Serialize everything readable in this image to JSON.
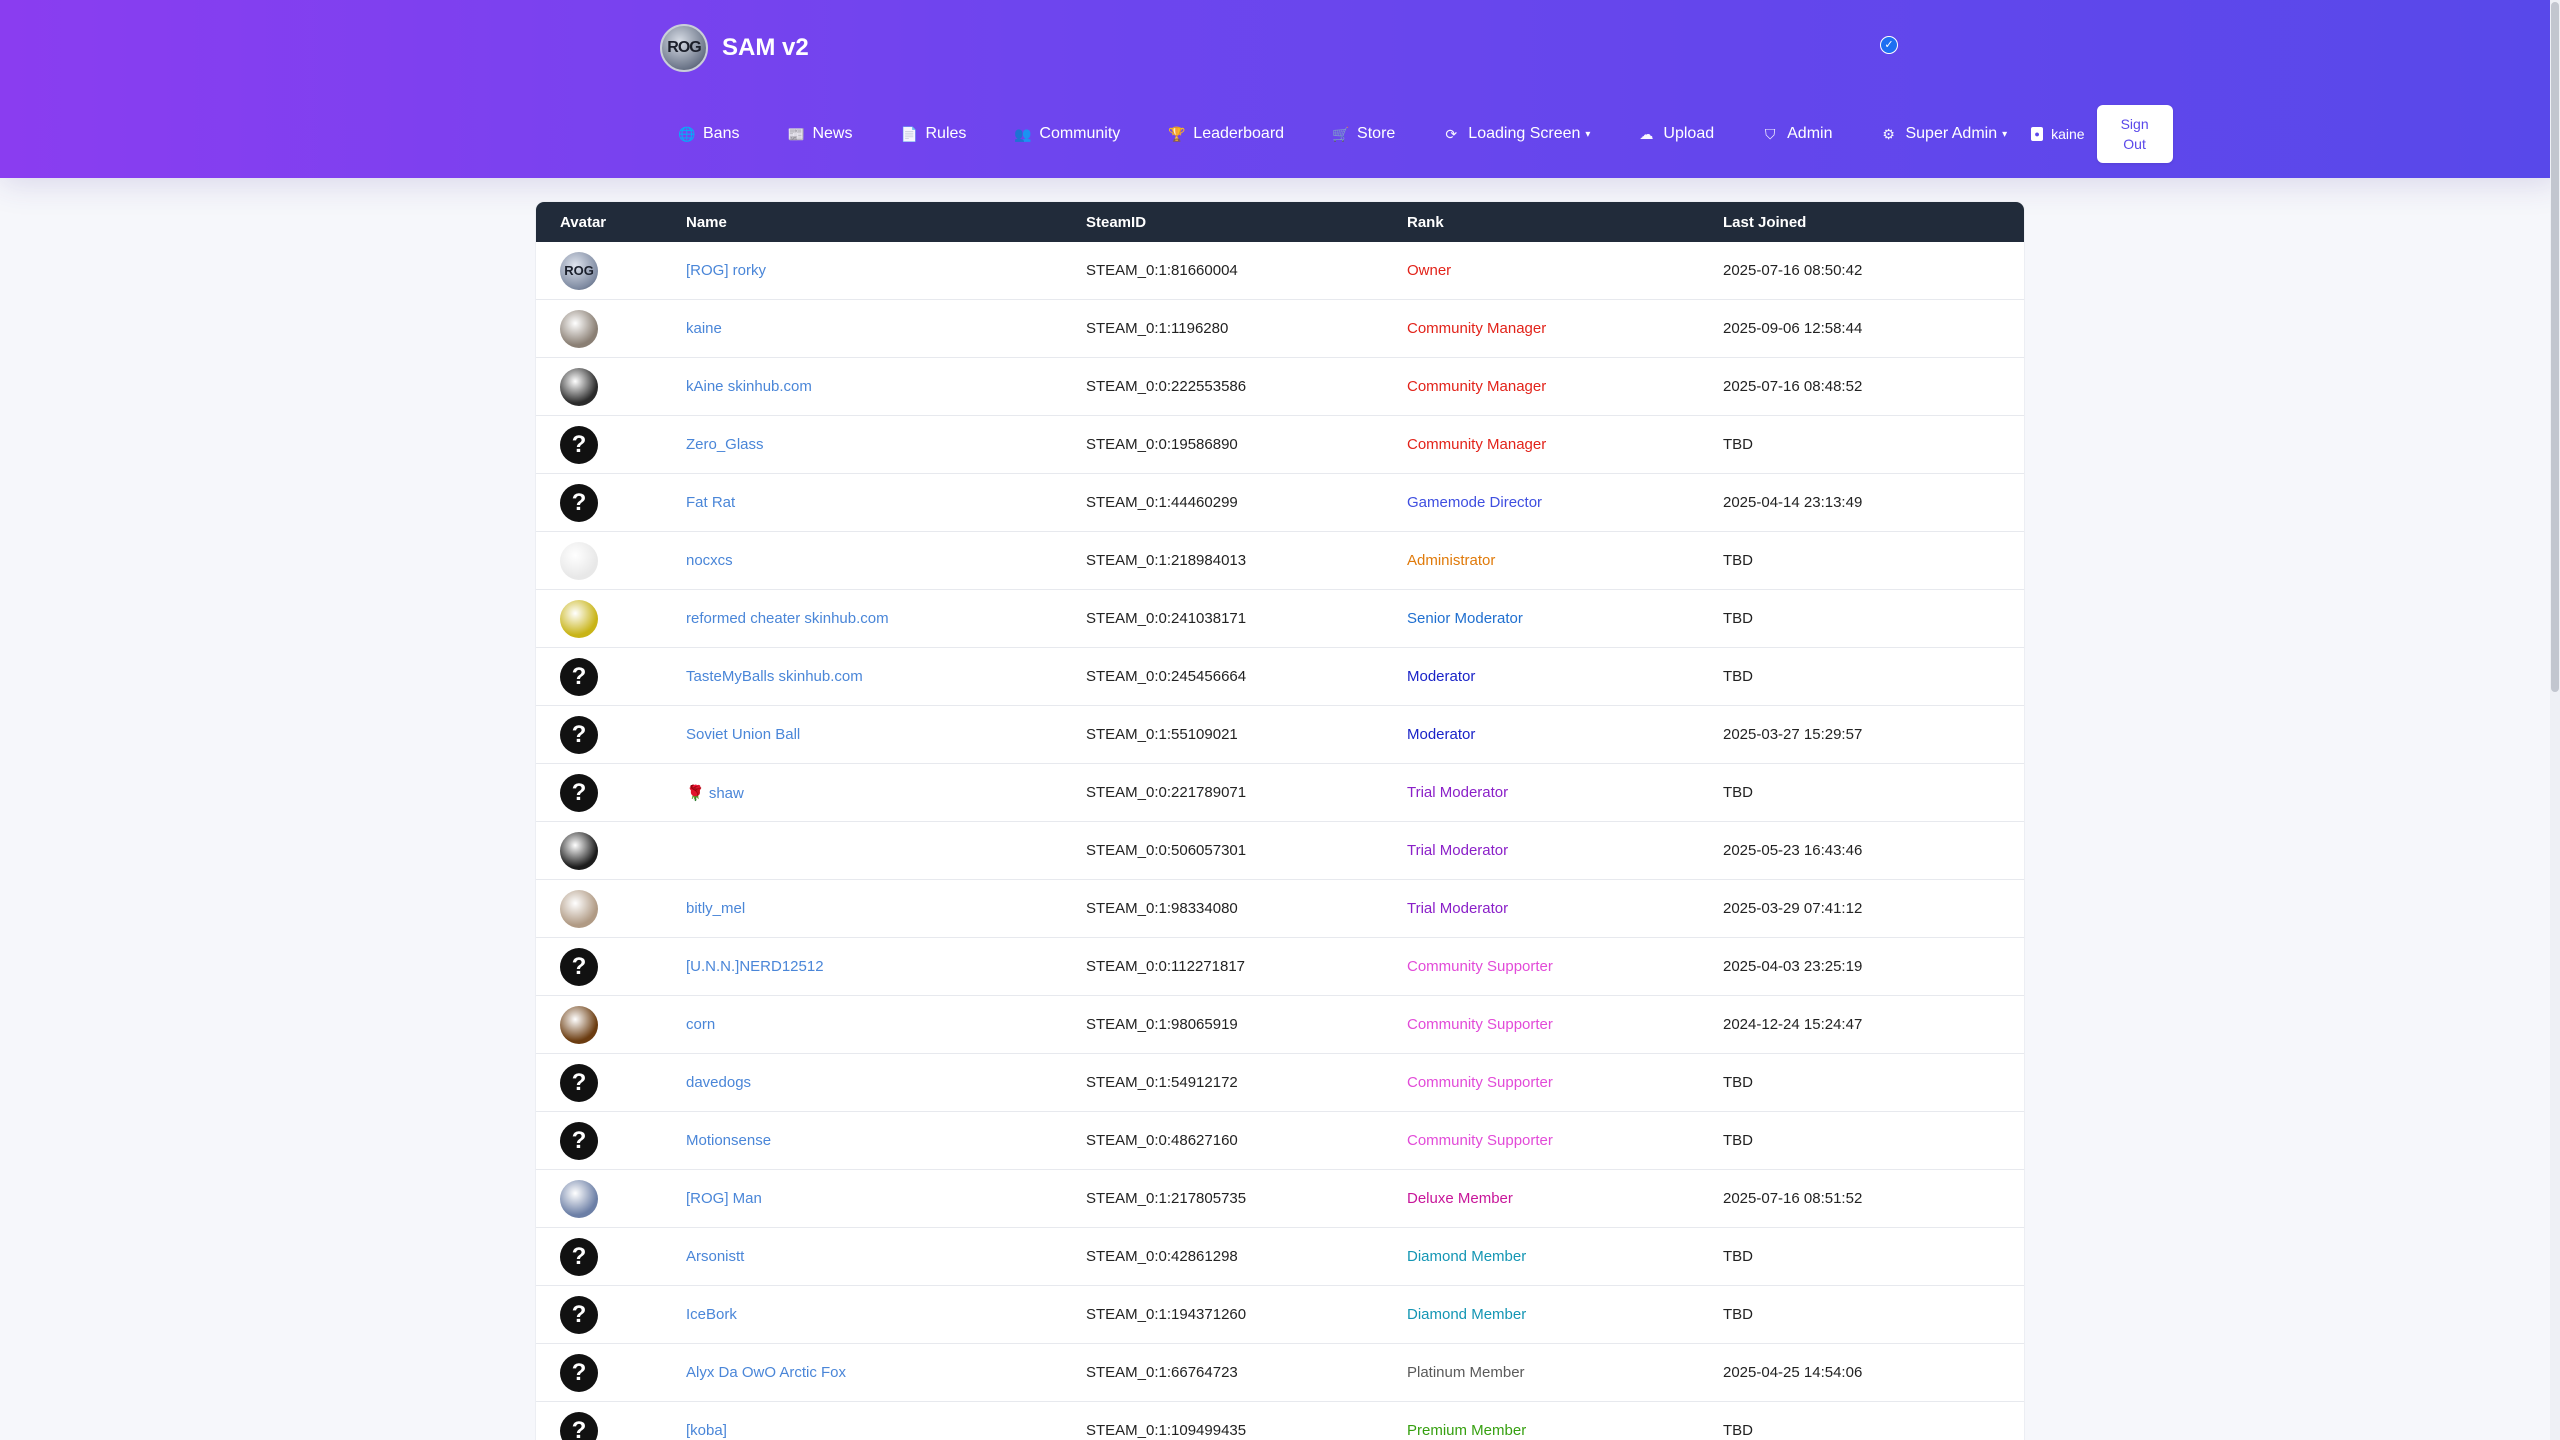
{
  "brand": {
    "title": "SAM v2",
    "logo_text": "ROG"
  },
  "nav": [
    {
      "label": "Bans",
      "icon": "globe-icon",
      "glyph": "🌐"
    },
    {
      "label": "News",
      "icon": "newspaper-icon",
      "glyph": "📰"
    },
    {
      "label": "Rules",
      "icon": "document-icon",
      "glyph": "📄"
    },
    {
      "label": "Community",
      "icon": "users-icon",
      "glyph": "👥"
    },
    {
      "label": "Leaderboard",
      "icon": "trophy-icon",
      "glyph": "🏆"
    },
    {
      "label": "Store",
      "icon": "cart-icon",
      "glyph": "🛒"
    },
    {
      "label": "Loading Screen",
      "icon": "refresh-icon",
      "glyph": "⟳",
      "dropdown": true
    },
    {
      "label": "Upload",
      "icon": "upload-icon",
      "glyph": "☁"
    },
    {
      "label": "Admin",
      "icon": "shield-icon",
      "glyph": "⛉"
    },
    {
      "label": "Super Admin",
      "icon": "gear-icon",
      "glyph": "⚙",
      "dropdown": true
    }
  ],
  "user": {
    "name": "kaine",
    "signout": "Sign Out"
  },
  "table": {
    "headers": [
      "Avatar",
      "Name",
      "SteamID",
      "Rank",
      "Last Joined"
    ],
    "rows": [
      {
        "avatar": "rog",
        "name": "[ROG] rorky",
        "steamid": "STEAM_0:1:81660004",
        "rank": "Owner",
        "rank_color": "#e2231a",
        "date": "2025-07-16 08:50:42"
      },
      {
        "avatar": "photo",
        "avatar_color": "#8a7f74",
        "name": "kaine",
        "steamid": "STEAM_0:1:1196280",
        "rank": "Community Manager",
        "rank_color": "#e2231a",
        "date": "2025-09-06 12:58:44"
      },
      {
        "avatar": "photo",
        "avatar_color": "#2b2b2b",
        "name": "kAine skinhub.com",
        "steamid": "STEAM_0:0:222553586",
        "rank": "Community Manager",
        "rank_color": "#e2231a",
        "date": "2025-07-16 08:48:52"
      },
      {
        "avatar": "default",
        "name": "Zero_Glass",
        "steamid": "STEAM_0:0:19586890",
        "rank": "Community Manager",
        "rank_color": "#e2231a",
        "date": "TBD"
      },
      {
        "avatar": "default",
        "name": "Fat Rat",
        "steamid": "STEAM_0:1:44460299",
        "rank": "Gamemode Director",
        "rank_color": "#3f4fe0",
        "date": "2025-04-14 23:13:49"
      },
      {
        "avatar": "photo",
        "avatar_color": "#e8e8e8",
        "name": "nocxcs",
        "steamid": "STEAM_0:1:218984013",
        "rank": "Administrator",
        "rank_color": "#e07a0a",
        "date": "TBD"
      },
      {
        "avatar": "photo",
        "avatar_color": "#c8b417",
        "name": "reformed cheater skinhub.com",
        "steamid": "STEAM_0:0:241038171",
        "rank": "Senior Moderator",
        "rank_color": "#1f6fd0",
        "date": "TBD"
      },
      {
        "avatar": "default",
        "name": "TasteMyBalls skinhub.com",
        "steamid": "STEAM_0:0:245456664",
        "rank": "Moderator",
        "rank_color": "#1a23c8",
        "date": "TBD"
      },
      {
        "avatar": "default",
        "name": "Soviet Union Ball",
        "steamid": "STEAM_0:1:55109021",
        "rank": "Moderator",
        "rank_color": "#1a23c8",
        "date": "2025-03-27 15:29:57"
      },
      {
        "avatar": "default",
        "name": "🌹 shaw",
        "steamid": "STEAM_0:0:221789071",
        "rank": "Trial Moderator",
        "rank_color": "#8a1fc8",
        "date": "TBD"
      },
      {
        "avatar": "photo",
        "avatar_color": "#1c1c1c",
        "name": "⁠⁠⁠⁠⁠⁠⁠⁠⁠⁠⁠⁠⁠⁠⁠⁠⁠⁠⁠⁠⁠⁠⁠⁠⁠⁠⁠⁠⁠⁠⁠⁠⁠⁠⁠⁠⁠⁠⁠⁠⁠⁠⁠⁠⁠⁠⁠⁠⁠",
        "steamid": "STEAM_0:0:506057301",
        "rank": "Trial Moderator",
        "rank_color": "#8a1fc8",
        "date": "2025-05-23 16:43:46"
      },
      {
        "avatar": "photo",
        "avatar_color": "#b09a84",
        "name": "bitly_mel",
        "steamid": "STEAM_0:1:98334080",
        "rank": "Trial Moderator",
        "rank_color": "#8a1fc8",
        "date": "2025-03-29 07:41:12"
      },
      {
        "avatar": "default",
        "name": "[U.N.N.]NERD12512",
        "steamid": "STEAM_0:0:112271817",
        "rank": "Community Supporter",
        "rank_color": "#e24bd8",
        "date": "2025-04-03 23:25:19"
      },
      {
        "avatar": "photo",
        "avatar_color": "#6b3c10",
        "name": "corn",
        "steamid": "STEAM_0:1:98065919",
        "rank": "Community Supporter",
        "rank_color": "#e24bd8",
        "date": "2024-12-24 15:24:47"
      },
      {
        "avatar": "default",
        "name": "davedogs",
        "steamid": "STEAM_0:1:54912172",
        "rank": "Community Supporter",
        "rank_color": "#e24bd8",
        "date": "TBD"
      },
      {
        "avatar": "default",
        "name": "Motionsense",
        "steamid": "STEAM_0:0:48627160",
        "rank": "Community Supporter",
        "rank_color": "#e24bd8",
        "date": "TBD"
      },
      {
        "avatar": "photo",
        "avatar_color": "#6c7fa6",
        "name": "[ROG] Man",
        "steamid": "STEAM_0:1:217805735",
        "rank": "Deluxe Member",
        "rank_color": "#c8169a",
        "date": "2025-07-16 08:51:52"
      },
      {
        "avatar": "default",
        "name": "Arsonistt",
        "steamid": "STEAM_0:0:42861298",
        "rank": "Diamond Member",
        "rank_color": "#1496b4",
        "date": "TBD"
      },
      {
        "avatar": "default",
        "name": "IceBork",
        "steamid": "STEAM_0:1:194371260",
        "rank": "Diamond Member",
        "rank_color": "#1496b4",
        "date": "TBD"
      },
      {
        "avatar": "default",
        "name": "Alyx Da OwO Arctic Fox",
        "steamid": "STEAM_0:1:66764723",
        "rank": "Platinum Member",
        "rank_color": "#5a5a5a",
        "date": "2025-04-25 14:54:06"
      },
      {
        "avatar": "default",
        "name": "[koba]",
        "steamid": "STEAM_0:1:109499435",
        "rank": "Premium Member",
        "rank_color": "#36a010",
        "date": "TBD"
      }
    ]
  }
}
